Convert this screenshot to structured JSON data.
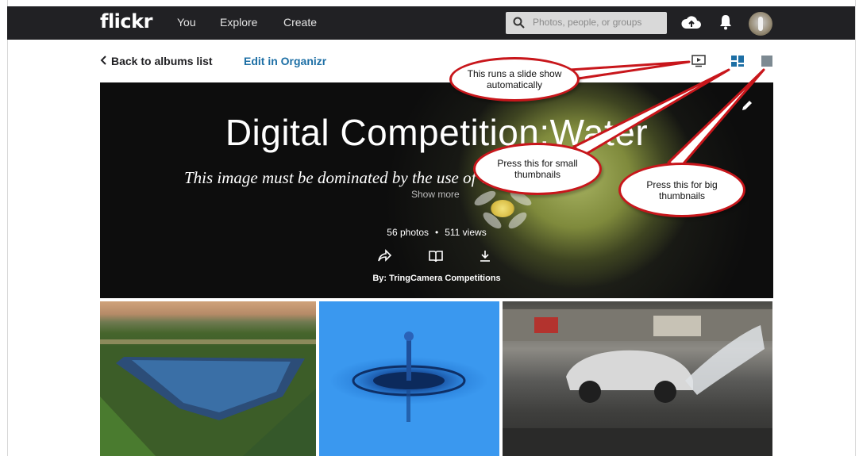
{
  "nav": {
    "logo": "flickr",
    "links": [
      "You",
      "Explore",
      "Create"
    ],
    "search_placeholder": "Photos, people, or groups"
  },
  "subheader": {
    "back_label": "Back to albums list",
    "edit_label": "Edit in Organizr"
  },
  "album": {
    "title": "Digital Competition:Water",
    "description": "This image must be dominated by the use of water",
    "show_more": "Show more",
    "photos": "56 photos",
    "separator": "•",
    "views": "511 views",
    "by": "By: TringCamera Competitions"
  },
  "callouts": {
    "slideshow": "This runs a slide show automatically",
    "small": "Press this for small thumbnails",
    "big": "Press this for big thumbnails"
  },
  "colors": {
    "nav_bg": "#212124",
    "link_blue": "#1d6fa5",
    "view_active": "#1d6fa5",
    "callout_border": "#c8161b"
  },
  "icons": [
    "search-icon",
    "upload-cloud-icon",
    "bell-icon",
    "slideshow-icon",
    "small-thumbnails-icon",
    "big-thumbnails-icon",
    "edit-pencil-icon",
    "share-icon",
    "book-icon",
    "download-icon",
    "chevron-left-icon"
  ]
}
